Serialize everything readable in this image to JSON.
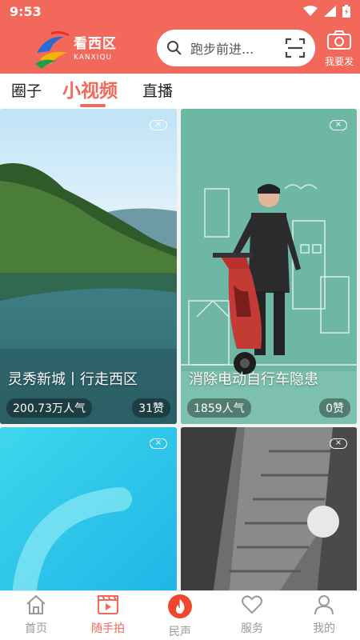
{
  "status_bar": {
    "time": "9:53"
  },
  "app": {
    "name_cn": "看西区",
    "name_en": "KANXIQU"
  },
  "search": {
    "placeholder": "跑步前进..."
  },
  "publish": {
    "label": "我要发"
  },
  "tabs": [
    {
      "label": "圈子",
      "active": false
    },
    {
      "label": "小视频",
      "active": true
    },
    {
      "label": "直播",
      "active": false
    }
  ],
  "cards": [
    {
      "title": "灵秀新城丨行走西区",
      "views": "200.73万人气",
      "likes": "31赞",
      "close": "×"
    },
    {
      "title": "消除电动自行车隐患",
      "views": "1859人气",
      "likes": "0赞",
      "close": "×"
    },
    {
      "title": "",
      "views": "",
      "likes": "",
      "close": "×"
    },
    {
      "title": "",
      "views": "",
      "likes": "",
      "close": "×"
    }
  ],
  "bottom_nav": [
    {
      "label": "首页",
      "icon": "home-icon",
      "active": false
    },
    {
      "label": "随手拍",
      "icon": "clapperboard-icon",
      "active": true
    },
    {
      "label": "民声",
      "icon": "flame-icon",
      "active": false
    },
    {
      "label": "服务",
      "icon": "heart-icon",
      "active": false
    },
    {
      "label": "我的",
      "icon": "person-icon",
      "active": false
    }
  ],
  "colors": {
    "brand": "#f2685a",
    "nav_inactive": "#9a9a9a"
  }
}
